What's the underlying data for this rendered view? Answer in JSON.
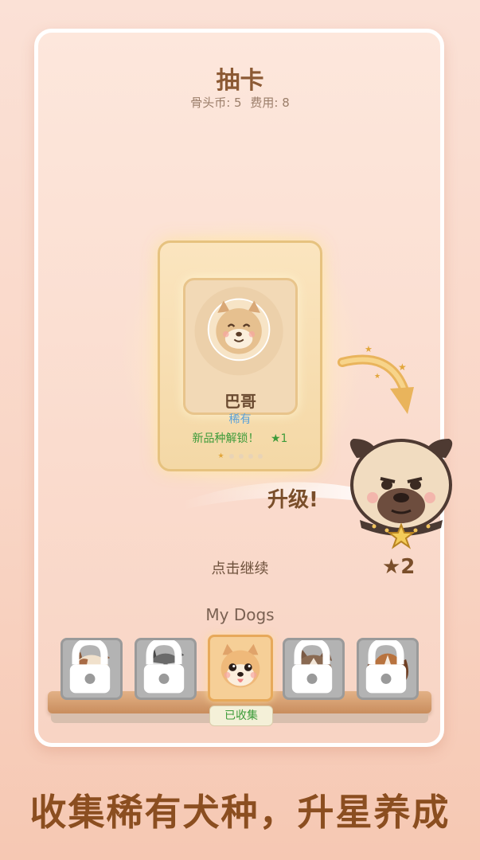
{
  "header": {
    "title": "抽卡",
    "bones_label": "骨头币: 5",
    "cost_label": "费用: 8"
  },
  "card": {
    "name": "巴哥",
    "rarity": "稀有",
    "unlock_text": "新品种解锁！",
    "star_text": "★1",
    "page_dots": 5,
    "active_dot": 1
  },
  "upgrade": {
    "label": "升级!",
    "level": "★2"
  },
  "prompt": {
    "tap_continue": "点击继续"
  },
  "collection": {
    "title": "My Dogs",
    "dogs": [
      {
        "breed": "bulldog",
        "locked": true
      },
      {
        "breed": "schnauzer",
        "locked": true
      },
      {
        "breed": "shiba",
        "locked": false
      },
      {
        "breed": "husky",
        "locked": true
      },
      {
        "breed": "beagle",
        "locked": true
      }
    ],
    "collected_badge": "已收集"
  },
  "banner": {
    "text": "收集稀有犬种，升星养成"
  },
  "colors": {
    "title_brown": "#8c5a34",
    "rarity_blue": "#5aa0d8",
    "success_green": "#3d9b3a",
    "banner_brown": "#8b4e20"
  }
}
